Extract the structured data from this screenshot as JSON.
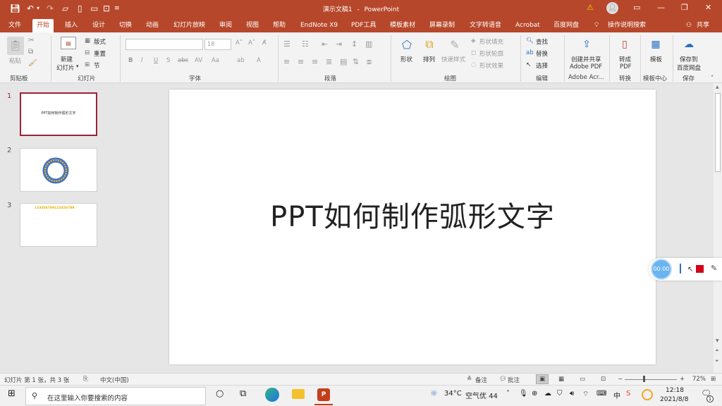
{
  "titlebar": {
    "doc_title": "演示文稿1",
    "separator": "-",
    "app_name": "PowerPoint",
    "warning_icon": "warning-icon",
    "avatar_icon": "user-avatar-icon"
  },
  "tabs": [
    {
      "label": "文件"
    },
    {
      "label": "开始"
    },
    {
      "label": "插入"
    },
    {
      "label": "设计"
    },
    {
      "label": "切换"
    },
    {
      "label": "动画"
    },
    {
      "label": "幻灯片放映"
    },
    {
      "label": "审阅"
    },
    {
      "label": "视图"
    },
    {
      "label": "帮助"
    },
    {
      "label": "EndNote X9"
    },
    {
      "label": "PDF工具"
    },
    {
      "label": "模板素材"
    },
    {
      "label": "屏幕录制"
    },
    {
      "label": "文字转语音"
    },
    {
      "label": "Acrobat"
    },
    {
      "label": "百度网盘"
    }
  ],
  "tell_me": "操作说明搜索",
  "share": "共享",
  "ribbon": {
    "clipboard": {
      "paste": "粘贴",
      "group": "剪贴板"
    },
    "slides": {
      "new_slide_1": "新建",
      "new_slide_2": "幻灯片",
      "layout": "版式",
      "reset": "重置",
      "section": "节",
      "group": "幻灯片"
    },
    "font": {
      "font_size": "18",
      "group": "字体"
    },
    "paragraph": {
      "group": "段落"
    },
    "drawing": {
      "shapes": "形状",
      "arrange": "排列",
      "quick_styles": "快速样式",
      "fill": "形状填充",
      "outline": "形状轮廓",
      "effects": "形状效果",
      "group": "绘图"
    },
    "editing": {
      "find": "查找",
      "replace": "替换",
      "select": "选择",
      "group": "编辑"
    },
    "adobe": {
      "line1": "创建并共享",
      "line2": "Adobe PDF",
      "group": "Adobe Acr..."
    },
    "convert": {
      "line1": "转成",
      "line2": "PDF",
      "group": "转换"
    },
    "template": {
      "line1": "模板",
      "group": "模板中心"
    },
    "save": {
      "line1": "保存到",
      "line2": "百度网盘",
      "group": "保存"
    }
  },
  "slides": [
    {
      "num": "1",
      "text": "PPT如何制作弧形文字"
    },
    {
      "num": "2",
      "text": ""
    },
    {
      "num": "3",
      "text": "123456789123456789"
    }
  ],
  "slide_title": "PPT如何制作弧形文字",
  "recorder": {
    "time": "00:00"
  },
  "status": {
    "slide_info": "幻灯片 第 1 张，共 3 张",
    "language": "中文(中国)",
    "notes": "备注",
    "comments": "批注",
    "zoom": "72%",
    "zoom_minus": "−",
    "zoom_plus": "+"
  },
  "taskbar": {
    "search_placeholder": "在这里输入你要搜索的内容",
    "weather": "34°C",
    "air": "空气优 44",
    "time": "12:18",
    "date": "2021/8/8",
    "notif_count": "1"
  }
}
